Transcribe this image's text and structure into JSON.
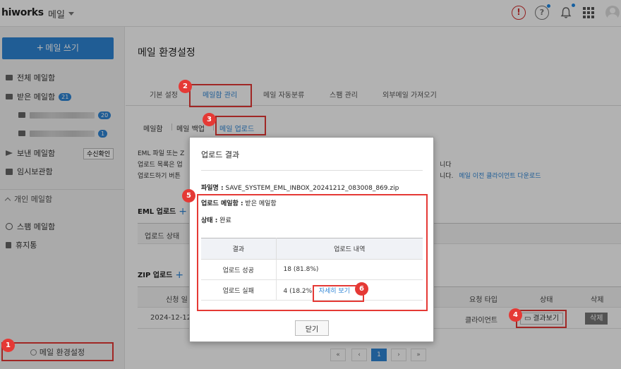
{
  "header": {
    "logo": "hiworks",
    "app_name": "메일"
  },
  "sidebar": {
    "compose_label": "메일 쓰기",
    "items": [
      {
        "label": "전체 메일함",
        "icon": "envelope-icon"
      },
      {
        "label": "받은 메일함",
        "badge": "21",
        "icon": "envelope-icon"
      },
      {
        "badge": "20",
        "icon": "envelope-icon"
      },
      {
        "badge": "1",
        "icon": "envelope-icon"
      },
      {
        "label": "보낸 메일함",
        "icon": "send-icon"
      },
      {
        "label": "임시보관함",
        "icon": "box-icon"
      }
    ],
    "receipt_button": "수신확인",
    "personal_section": "개인 메일함",
    "spam": "스팸 메일함",
    "trash": "휴지통",
    "settings_link": "메일 환경설정"
  },
  "main": {
    "title": "메일 환경설정",
    "tabs": [
      "기본 설정",
      "메일함 관리",
      "메일 자동분류",
      "스팸 관리",
      "외부메일 가져오기"
    ],
    "subtabs": [
      "메일함",
      "메일 백업",
      "메일 업로드"
    ],
    "desc": [
      "EML 파일 또는 Z",
      "업로드 목록은 업",
      "업로드하기 버튼"
    ],
    "desc_right": [
      "니다",
      "니다."
    ],
    "desc_link": "메일 이전 클라이언트 다운로드",
    "eml_section": "EML 업로드",
    "eml_col": "업로드 상태",
    "zip_section": "ZIP 업로드",
    "zip_cols": [
      "신청 일",
      "요청 타입",
      "상태",
      "삭제"
    ],
    "zip_row": {
      "date": "2024-12-12",
      "type": "클라이언트",
      "result_button": "결과보기",
      "delete_button": "삭제"
    },
    "page": "1"
  },
  "modal": {
    "title": "업로드 결과",
    "file_label": "파일명 :",
    "file_name": "SAVE_SYSTEM_EML_INBOX_20241212_083008_869.zip",
    "mailbox_label": "업로드 메일함 :",
    "mailbox_value": "받은 메일함",
    "status_label": "상태 :",
    "status_value": "완료",
    "table": {
      "headers": [
        "결과",
        "업로드 내역"
      ],
      "rows": [
        {
          "result": "업로드 성공",
          "detail": "18 (81.8%)"
        },
        {
          "result": "업로드 실패",
          "detail": "4 (18.2%)",
          "link": "자세히 보기"
        }
      ]
    },
    "close_label": "닫기"
  },
  "steps": [
    "1",
    "2",
    "3",
    "4",
    "5",
    "6"
  ]
}
